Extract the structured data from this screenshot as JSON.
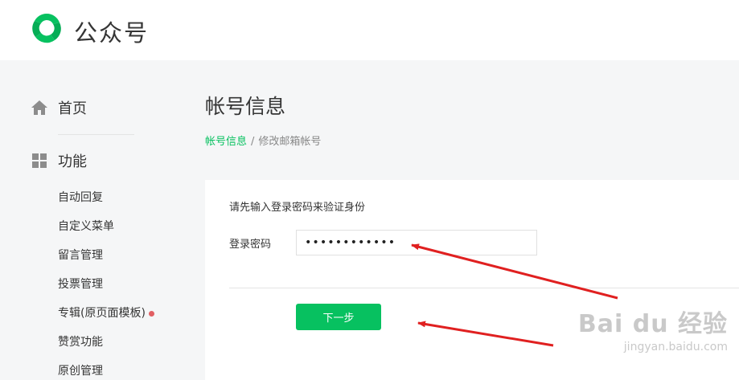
{
  "header": {
    "brand": "公众号"
  },
  "sidebar": {
    "home_label": "首页",
    "func_label": "功能",
    "sub_items": [
      "自动回复",
      "自定义菜单",
      "留言管理",
      "投票管理",
      "专辑(原页面模板)",
      "赞赏功能",
      "原创管理"
    ]
  },
  "main": {
    "title": "帐号信息",
    "breadcrumb": {
      "link": "帐号信息",
      "separator": "/",
      "current": "修改邮箱帐号"
    },
    "hint": "请先输入登录密码来验证身份",
    "password_label": "登录密码",
    "password_value": "••••••••••••",
    "next_button": "下一步"
  },
  "watermark": {
    "main": "Bai du 经验",
    "sub": "jingyan.baidu.com"
  },
  "colors": {
    "accent": "#07c160",
    "annotation_arrow": "#e02020",
    "badge": "#e15f63"
  }
}
